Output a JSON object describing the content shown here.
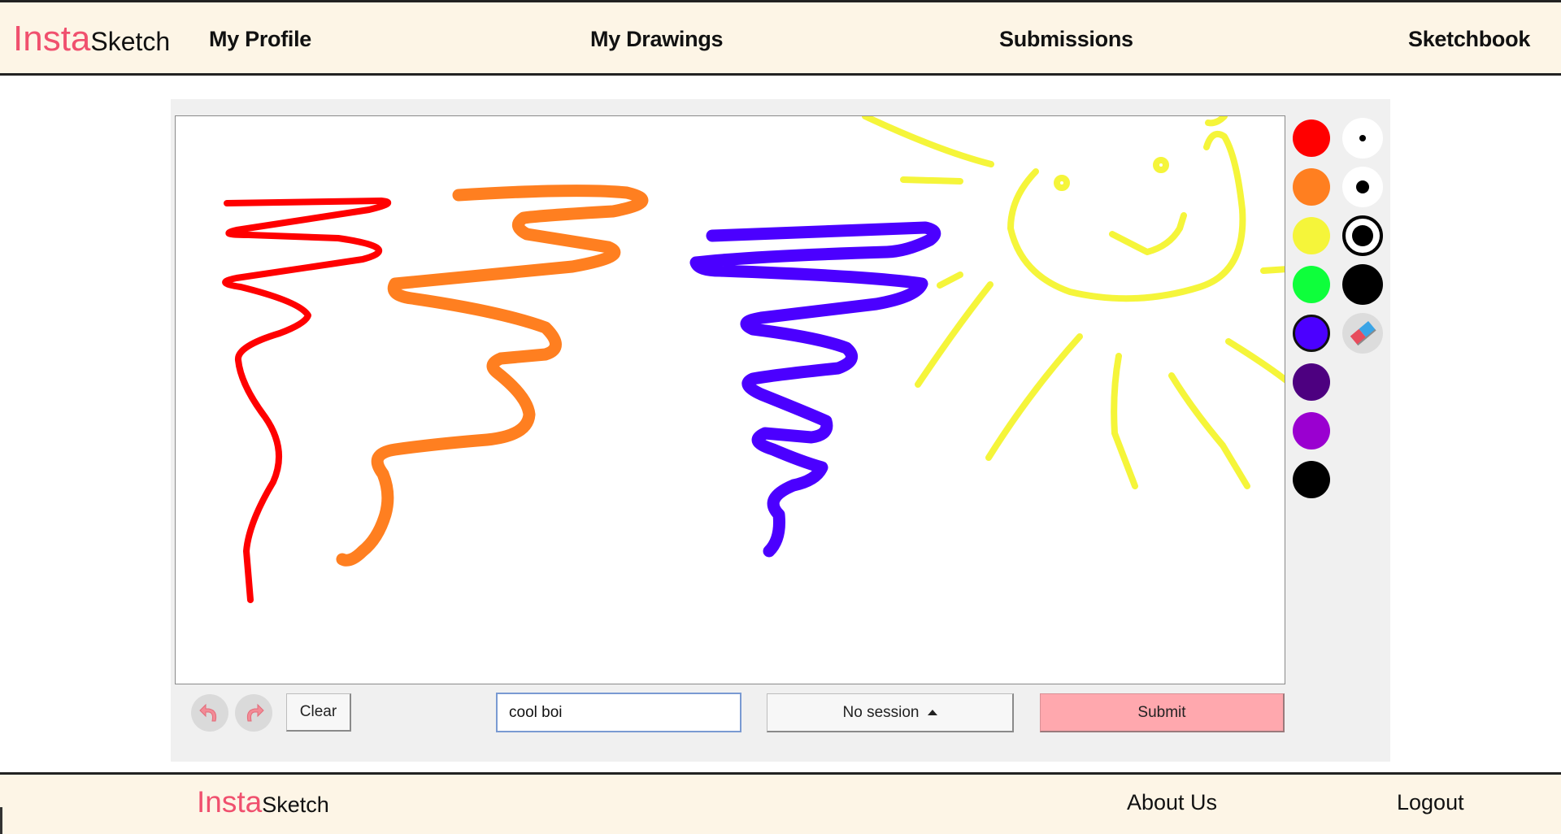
{
  "brand": {
    "part1": "Insta",
    "part2": "Sketch"
  },
  "nav": {
    "my_profile": "My Profile",
    "my_drawings": "My Drawings",
    "submissions": "Submissions",
    "sketchbook": "Sketchbook"
  },
  "palette": {
    "colors": [
      {
        "name": "red",
        "hex": "#ff0000"
      },
      {
        "name": "orange",
        "hex": "#ff7f20"
      },
      {
        "name": "yellow",
        "hex": "#f5f53a"
      },
      {
        "name": "green",
        "hex": "#0eff3b"
      },
      {
        "name": "blue-violet",
        "hex": "#4b00ff"
      },
      {
        "name": "dark-purple",
        "hex": "#4d0080"
      },
      {
        "name": "purple",
        "hex": "#9a00d0"
      },
      {
        "name": "black",
        "hex": "#000000"
      }
    ],
    "selected_color": "blue-violet"
  },
  "brush": {
    "sizes": [
      "small",
      "medium",
      "large",
      "extra-large"
    ],
    "selected_size": "large",
    "eraser_icon": "eraser-icon"
  },
  "controls": {
    "undo_icon": "undo-icon",
    "redo_icon": "redo-icon",
    "clear_label": "Clear",
    "title_value": "cool boi",
    "session_label": "No session",
    "submit_label": "Submit"
  },
  "footer": {
    "about_us": "About Us",
    "logout": "Logout"
  }
}
